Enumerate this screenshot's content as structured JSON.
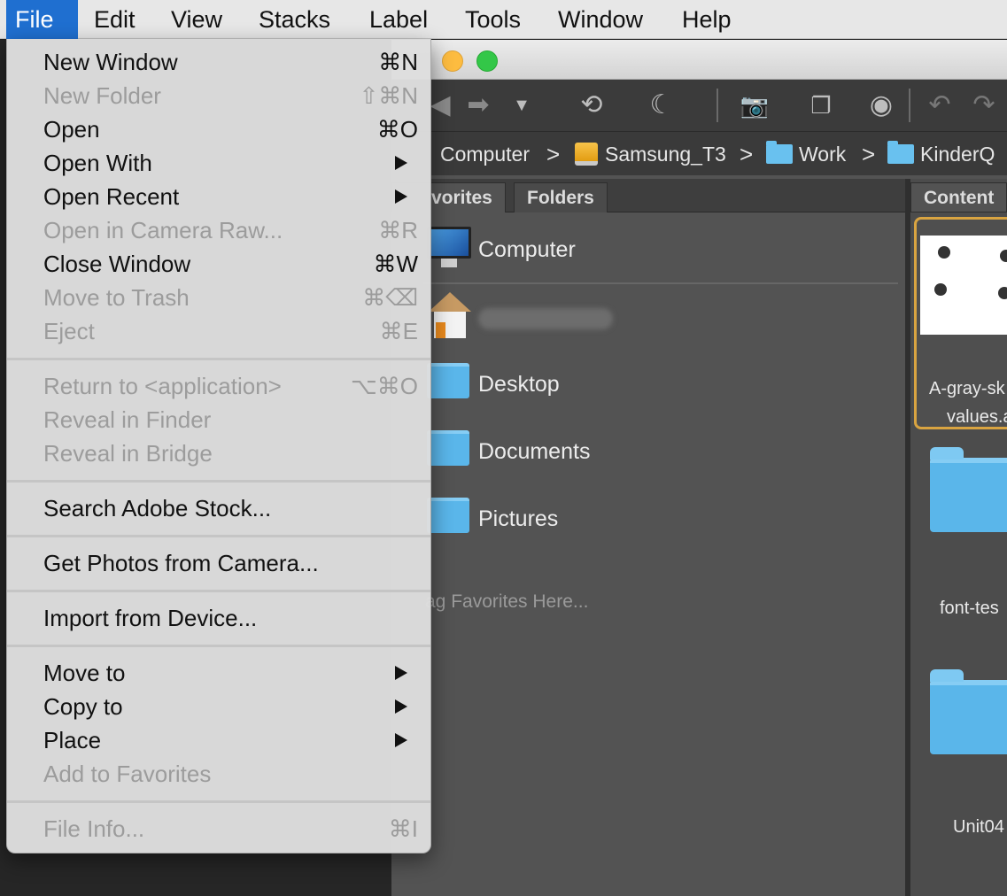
{
  "menubar": {
    "items": [
      "File",
      "Edit",
      "View",
      "Stacks",
      "Label",
      "Tools",
      "Window",
      "Help"
    ]
  },
  "file_menu": {
    "items": [
      {
        "label": "New Window",
        "shortcut": "⌘N",
        "enabled": true
      },
      {
        "label": "New Folder",
        "shortcut": "⇧⌘N",
        "enabled": false
      },
      {
        "label": "Open",
        "shortcut": "⌘O",
        "enabled": true
      },
      {
        "label": "Open With",
        "shortcut": "",
        "submenu": true,
        "enabled": true
      },
      {
        "label": "Open Recent",
        "shortcut": "",
        "submenu": true,
        "enabled": true
      },
      {
        "label": "Open in Camera Raw...",
        "shortcut": "⌘R",
        "enabled": false
      },
      {
        "label": "Close Window",
        "shortcut": "⌘W",
        "enabled": true
      },
      {
        "label": "Move to Trash",
        "shortcut": "⌘⌫",
        "enabled": false
      },
      {
        "label": "Eject",
        "shortcut": "⌘E",
        "enabled": false
      },
      {
        "label": "Return to <application>",
        "shortcut": "⌥⌘O",
        "enabled": false
      },
      {
        "label": "Reveal in Finder",
        "shortcut": "",
        "enabled": false
      },
      {
        "label": "Reveal in Bridge",
        "shortcut": "",
        "enabled": false
      },
      {
        "label": "Search Adobe Stock...",
        "shortcut": "",
        "enabled": true
      },
      {
        "label": "Get Photos from Camera...",
        "shortcut": "",
        "enabled": true
      },
      {
        "label": "Import from Device...",
        "shortcut": "",
        "enabled": true
      },
      {
        "label": "Move to",
        "shortcut": "",
        "submenu": true,
        "enabled": true
      },
      {
        "label": "Copy to",
        "shortcut": "",
        "submenu": true,
        "enabled": true
      },
      {
        "label": "Place",
        "shortcut": "",
        "submenu": true,
        "enabled": true
      },
      {
        "label": "Add to Favorites",
        "shortcut": "",
        "enabled": false
      },
      {
        "label": "File Info...",
        "shortcut": "⌘I",
        "enabled": false
      }
    ]
  },
  "pathbar": {
    "crumbs": [
      "Computer",
      "Samsung_T3",
      "Work",
      "KinderQ"
    ],
    "separator": ">"
  },
  "panels": {
    "favorites_tab": "Favorites",
    "favorites_tab_visible": "vorites",
    "folders_tab": "Folders",
    "content_tab": "Content"
  },
  "favorites": {
    "items": [
      "Computer",
      "",
      "Desktop",
      "Documents",
      "Pictures"
    ],
    "drag_hint": "ag Favorites Here..."
  },
  "content": {
    "thumb1_name_line1": "A-gray-sk",
    "thumb1_name_line2": "values.a",
    "folder1_name": "font-tes",
    "folder2_name": "Unit04"
  },
  "toolbar": {
    "icons": [
      "back-arrow-icon",
      "forward-arrow-icon",
      "dropdown-icon",
      "recent-clock-icon",
      "boomerang-icon",
      "camera-download-icon",
      "refine-icon",
      "open-camera-raw-icon",
      "rotate-left-icon",
      "rotate-right-icon"
    ]
  },
  "colors": {
    "menu_highlight": "#1f6fd0",
    "thumb_selection": "#d9a441",
    "folder_blue": "#5ab6ea"
  }
}
